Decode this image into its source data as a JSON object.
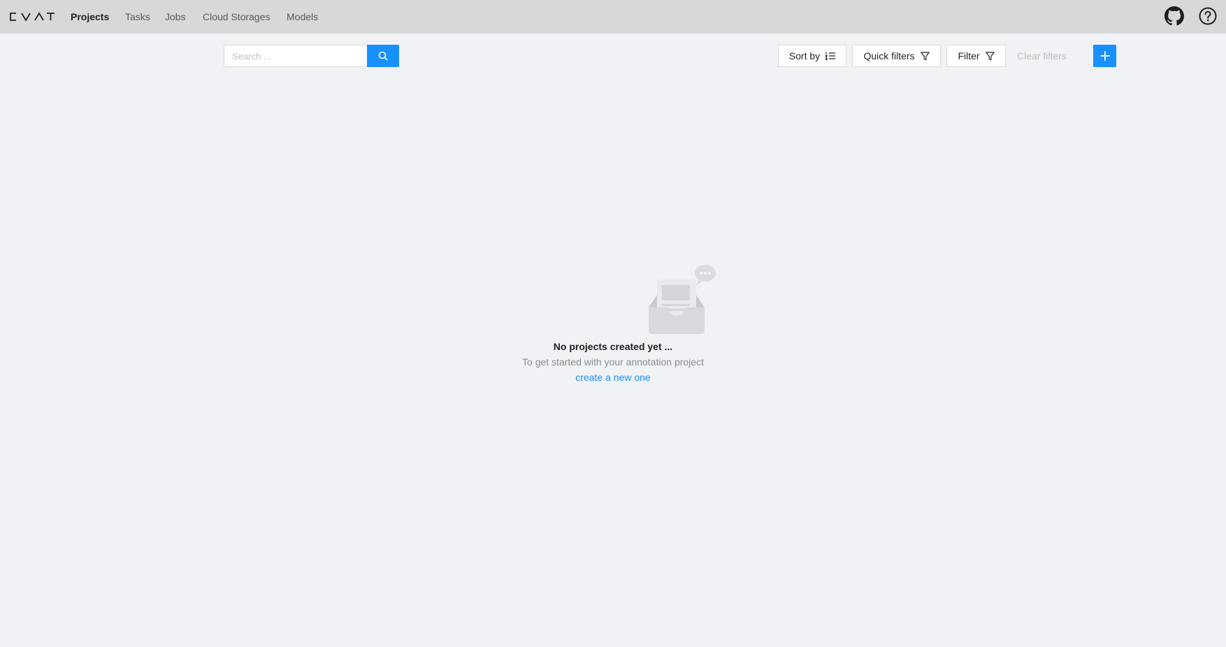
{
  "header": {
    "logo": "CVAT",
    "nav": [
      {
        "label": "Projects",
        "active": true
      },
      {
        "label": "Tasks",
        "active": false
      },
      {
        "label": "Jobs",
        "active": false
      },
      {
        "label": "Cloud Storages",
        "active": false
      },
      {
        "label": "Models",
        "active": false
      }
    ],
    "icons": [
      "github-icon",
      "help-circle-icon"
    ]
  },
  "toolbar": {
    "search_placeholder": "Search ...",
    "sort_label": "Sort by",
    "quick_filters_label": "Quick filters",
    "filter_label": "Filter",
    "clear_filters_label": "Clear filters"
  },
  "empty_state": {
    "title": "No projects created yet ...",
    "subtitle": "To get started with your annotation project",
    "link": "create a new one"
  },
  "colors": {
    "primary": "#1890ff",
    "header_bg": "#d8d8d8",
    "page_bg": "#f0f2f5"
  }
}
